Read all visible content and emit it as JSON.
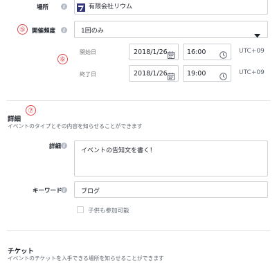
{
  "location": {
    "label": "場所",
    "value": "有限会社リウム",
    "logo_color": "#2f3577"
  },
  "frequency": {
    "marker": "⑤",
    "label": "開催頻度",
    "value": "1回のみ"
  },
  "schedule": {
    "marker": "⑥",
    "start": {
      "label": "開始日",
      "date": "2018/1/26",
      "time": "16:00",
      "timezone": "UTC+09"
    },
    "end": {
      "label": "終了日",
      "date": "2018/1/26",
      "time": "19:00",
      "timezone": "UTC+09"
    }
  },
  "details_section": {
    "marker": "⑦",
    "title": "詳細",
    "description": "イベントのタイプとその内容を知らせることができます",
    "details_label": "詳細",
    "details_value": "イベントの告知文を書く！",
    "keyword_label": "キーワード",
    "keyword_value": "ブログ",
    "kids_checkbox_label": "子供も参加可能"
  },
  "ticket_section": {
    "title": "チケット",
    "description": "イベントのチケットを入手できる場所を知らせることができます"
  },
  "colors": {
    "marker_red": "#e0454a",
    "border": "#cdd0d4"
  }
}
